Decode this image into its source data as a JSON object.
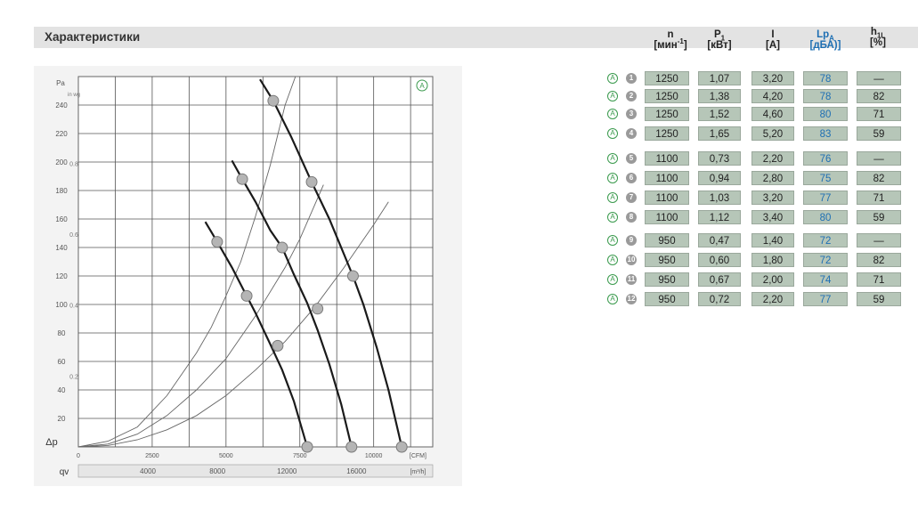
{
  "page": {
    "title": "Характеристики"
  },
  "table": {
    "headers": [
      {
        "main": "n",
        "sub": "",
        "sup": "",
        "second": "[мин",
        "second_sup": "-1",
        "second_end": "]",
        "blue": false
      },
      {
        "main": "P",
        "sub": "1",
        "sup": "",
        "second": "[кВт]",
        "second_sup": "",
        "second_end": "",
        "blue": false
      },
      {
        "main": "I",
        "sub": "",
        "sup": "",
        "second": "[A]",
        "second_sup": "",
        "second_end": "",
        "blue": false
      },
      {
        "main": "Lp",
        "sub": "A",
        "sup": "",
        "second": "[дБА)]",
        "second_sup": "",
        "second_end": "",
        "blue": true
      },
      {
        "main": "h",
        "sub": "",
        "sup": "",
        "second": "[%]",
        "second_sup": "",
        "second_end": "",
        "blue": false,
        "main_small": "1L"
      }
    ],
    "rows": [
      {
        "mark": "A",
        "num": "1",
        "n": "1250",
        "p1": "1,07",
        "i": "3,20",
        "lpa": "78",
        "h": "—"
      },
      {
        "mark": "A",
        "num": "2",
        "n": "1250",
        "p1": "1,38",
        "i": "4,20",
        "lpa": "78",
        "h": "82"
      },
      {
        "mark": "A",
        "num": "3",
        "n": "1250",
        "p1": "1,52",
        "i": "4,60",
        "lpa": "80",
        "h": "71"
      },
      {
        "mark": "A",
        "num": "4",
        "n": "1250",
        "p1": "1,65",
        "i": "5,20",
        "lpa": "83",
        "h": "59"
      },
      {
        "mark": "A",
        "num": "5",
        "n": "1100",
        "p1": "0,73",
        "i": "2,20",
        "lpa": "76",
        "h": "—"
      },
      {
        "mark": "A",
        "num": "6",
        "n": "1100",
        "p1": "0,94",
        "i": "2,80",
        "lpa": "75",
        "h": "82"
      },
      {
        "mark": "A",
        "num": "7",
        "n": "1100",
        "p1": "1,03",
        "i": "3,20",
        "lpa": "77",
        "h": "71"
      },
      {
        "mark": "A",
        "num": "8",
        "n": "1100",
        "p1": "1,12",
        "i": "3,40",
        "lpa": "80",
        "h": "59"
      },
      {
        "mark": "A",
        "num": "9",
        "n": "950",
        "p1": "0,47",
        "i": "1,40",
        "lpa": "72",
        "h": "—"
      },
      {
        "mark": "A",
        "num": "10",
        "n": "950",
        "p1": "0,60",
        "i": "1,80",
        "lpa": "72",
        "h": "82"
      },
      {
        "mark": "A",
        "num": "11",
        "n": "950",
        "p1": "0,67",
        "i": "2,00",
        "lpa": "74",
        "h": "71"
      },
      {
        "mark": "A",
        "num": "12",
        "n": "950",
        "p1": "0,72",
        "i": "2,20",
        "lpa": "77",
        "h": "59"
      }
    ]
  },
  "chart_data": {
    "type": "line",
    "corner_label": "A",
    "x_cfm": {
      "ticks": [
        0,
        2500,
        5000,
        7500,
        10000
      ],
      "unit": "[CFM]",
      "range": [
        0,
        12000
      ]
    },
    "x_m3h": {
      "ticks": [
        4000,
        8000,
        12000,
        16000
      ],
      "unit": "[m³/h]",
      "range": [
        0,
        20388
      ]
    },
    "y_pa": {
      "ticks": [
        20,
        40,
        60,
        80,
        100,
        120,
        140,
        160,
        180,
        200,
        220,
        240
      ],
      "range": [
        0,
        260
      ],
      "axis_symbol": "Pa"
    },
    "y_inwg": {
      "ticks": [
        0.2,
        0.4,
        0.6,
        0.8
      ],
      "axis_symbol": "in wg"
    },
    "axis_label_left": "Δp",
    "axis_label_bottom": "qv",
    "series": [
      {
        "points": [
          [
            6150,
            258
          ],
          [
            6600,
            243
          ],
          [
            7200,
            218
          ],
          [
            7900,
            186
          ],
          [
            8500,
            160
          ],
          [
            9000,
            135
          ],
          [
            9300,
            120
          ],
          [
            9650,
            100
          ],
          [
            10100,
            70
          ],
          [
            10500,
            40
          ],
          [
            10950,
            0
          ]
        ]
      },
      {
        "points": [
          [
            5200,
            201
          ],
          [
            5550,
            188
          ],
          [
            6000,
            172
          ],
          [
            6500,
            152
          ],
          [
            6900,
            140
          ],
          [
            7300,
            121
          ],
          [
            7750,
            101
          ],
          [
            8100,
            82
          ],
          [
            8500,
            58
          ],
          [
            8900,
            30
          ],
          [
            9250,
            0
          ]
        ]
      },
      {
        "points": [
          [
            4300,
            158
          ],
          [
            4700,
            144
          ],
          [
            5200,
            126
          ],
          [
            5600,
            110
          ],
          [
            6000,
            94
          ],
          [
            6500,
            72
          ],
          [
            6900,
            54
          ],
          [
            7300,
            32
          ],
          [
            7750,
            0
          ]
        ]
      }
    ],
    "system_curves": [
      {
        "points": [
          [
            0,
            0
          ],
          [
            1000,
            4
          ],
          [
            2000,
            14
          ],
          [
            3000,
            36
          ],
          [
            4000,
            66
          ],
          [
            4500,
            84
          ],
          [
            5000,
            106
          ],
          [
            5500,
            130
          ],
          [
            6000,
            162
          ],
          [
            6500,
            198
          ],
          [
            7000,
            240
          ],
          [
            7350,
            268
          ]
        ]
      },
      {
        "points": [
          [
            0,
            0
          ],
          [
            1000,
            2
          ],
          [
            2000,
            9
          ],
          [
            3000,
            22
          ],
          [
            4000,
            40
          ],
          [
            5000,
            62
          ],
          [
            6000,
            92
          ],
          [
            7000,
            126
          ],
          [
            7500,
            146
          ],
          [
            8300,
            184
          ]
        ]
      },
      {
        "points": [
          [
            0,
            0
          ],
          [
            1000,
            1
          ],
          [
            2000,
            5
          ],
          [
            3000,
            12
          ],
          [
            4000,
            22
          ],
          [
            5000,
            36
          ],
          [
            6000,
            54
          ],
          [
            7000,
            74
          ],
          [
            8000,
            98
          ],
          [
            9000,
            126
          ],
          [
            10000,
            156
          ],
          [
            10500,
            172
          ]
        ]
      }
    ],
    "markers": [
      {
        "x": 6600,
        "y": 243
      },
      {
        "x": 7900,
        "y": 186
      },
      {
        "x": 9300,
        "y": 120
      },
      {
        "x": 10950,
        "y": 0
      },
      {
        "x": 5550,
        "y": 188
      },
      {
        "x": 6900,
        "y": 140
      },
      {
        "x": 8100,
        "y": 97
      },
      {
        "x": 9250,
        "y": 0
      },
      {
        "x": 4700,
        "y": 144
      },
      {
        "x": 5700,
        "y": 106
      },
      {
        "x": 6750,
        "y": 71
      },
      {
        "x": 7750,
        "y": 0
      }
    ],
    "grid": true
  }
}
